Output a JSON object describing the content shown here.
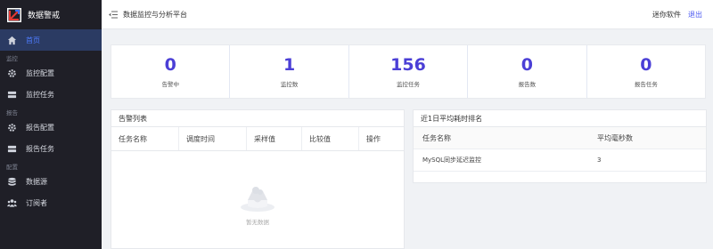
{
  "app": {
    "title": "数据警戒"
  },
  "sidebar": {
    "active": {
      "label": "首页",
      "icon": "home-icon"
    },
    "groups": [
      {
        "title": "监控",
        "items": [
          {
            "label": "监控配置",
            "icon": "gear-icon"
          },
          {
            "label": "监控任务",
            "icon": "task-icon"
          }
        ]
      },
      {
        "title": "报告",
        "items": [
          {
            "label": "报告配置",
            "icon": "gear-icon"
          },
          {
            "label": "报告任务",
            "icon": "task-icon"
          }
        ]
      },
      {
        "title": "配置",
        "items": [
          {
            "label": "数据源",
            "icon": "database-icon"
          },
          {
            "label": "订阅者",
            "icon": "users-icon"
          }
        ]
      }
    ]
  },
  "header": {
    "title": "数据监控与分析平台",
    "user": "迷你软件",
    "logout": "退出"
  },
  "stats": [
    {
      "value": "0",
      "label": "告警中"
    },
    {
      "value": "1",
      "label": "监控数"
    },
    {
      "value": "156",
      "label": "监控任务"
    },
    {
      "value": "0",
      "label": "报告数"
    },
    {
      "value": "0",
      "label": "报告任务"
    }
  ],
  "alarm_panel": {
    "title": "告警列表",
    "columns": [
      "任务名称",
      "调度时间",
      "采样值",
      "比较值",
      "操作"
    ],
    "empty_text": "暂无数据"
  },
  "rank_panel": {
    "title": "近1日平均耗时排名",
    "columns": [
      "任务名称",
      "平均毫秒数"
    ],
    "rows": [
      {
        "name": "MySQL同步延迟监控",
        "ms": "3"
      }
    ]
  },
  "colors": {
    "accent": "#4b3fd6",
    "sidebar_bg": "#1f1f27",
    "active_bg": "#2b3b63",
    "link": "#4e5bf1"
  }
}
